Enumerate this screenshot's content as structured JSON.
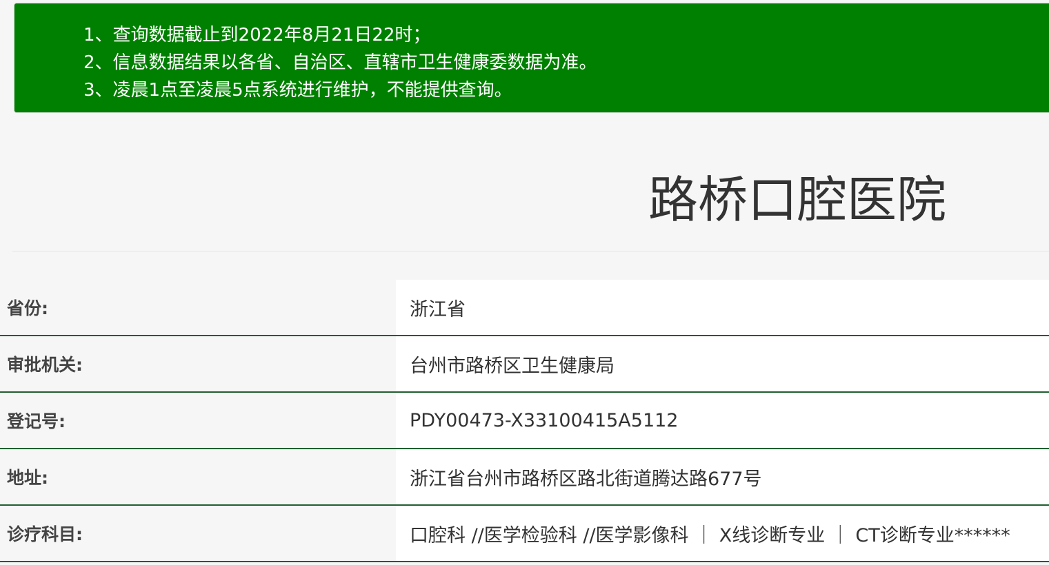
{
  "notice": {
    "lines": [
      "1、查询数据截止到2022年8月21日22时；",
      "2、信息数据结果以各省、自治区、直辖市卫生健康委数据为准。",
      "3、凌晨1点至凌晨5点系统进行维护，不能提供查询。"
    ]
  },
  "hospital": {
    "name": "路桥口腔医院"
  },
  "info": {
    "rows": [
      {
        "label": "省份:",
        "value": "浙江省"
      },
      {
        "label": "审批机关:",
        "value": "台州市路桥区卫生健康局"
      },
      {
        "label": "登记号:",
        "value": "PDY00473-X33100415A5112"
      },
      {
        "label": "地址:",
        "value": "浙江省台州市路桥区路北街道腾达路677号"
      },
      {
        "label": "诊疗科目:",
        "value": "口腔科 //医学检验科 //医学影像科 ｜ X线诊断专业 ｜ CT诊断专业******"
      }
    ]
  },
  "colors": {
    "notice_background": "#008000",
    "row_divider": "#1f5f2f",
    "page_background": "#f6f6f6"
  }
}
